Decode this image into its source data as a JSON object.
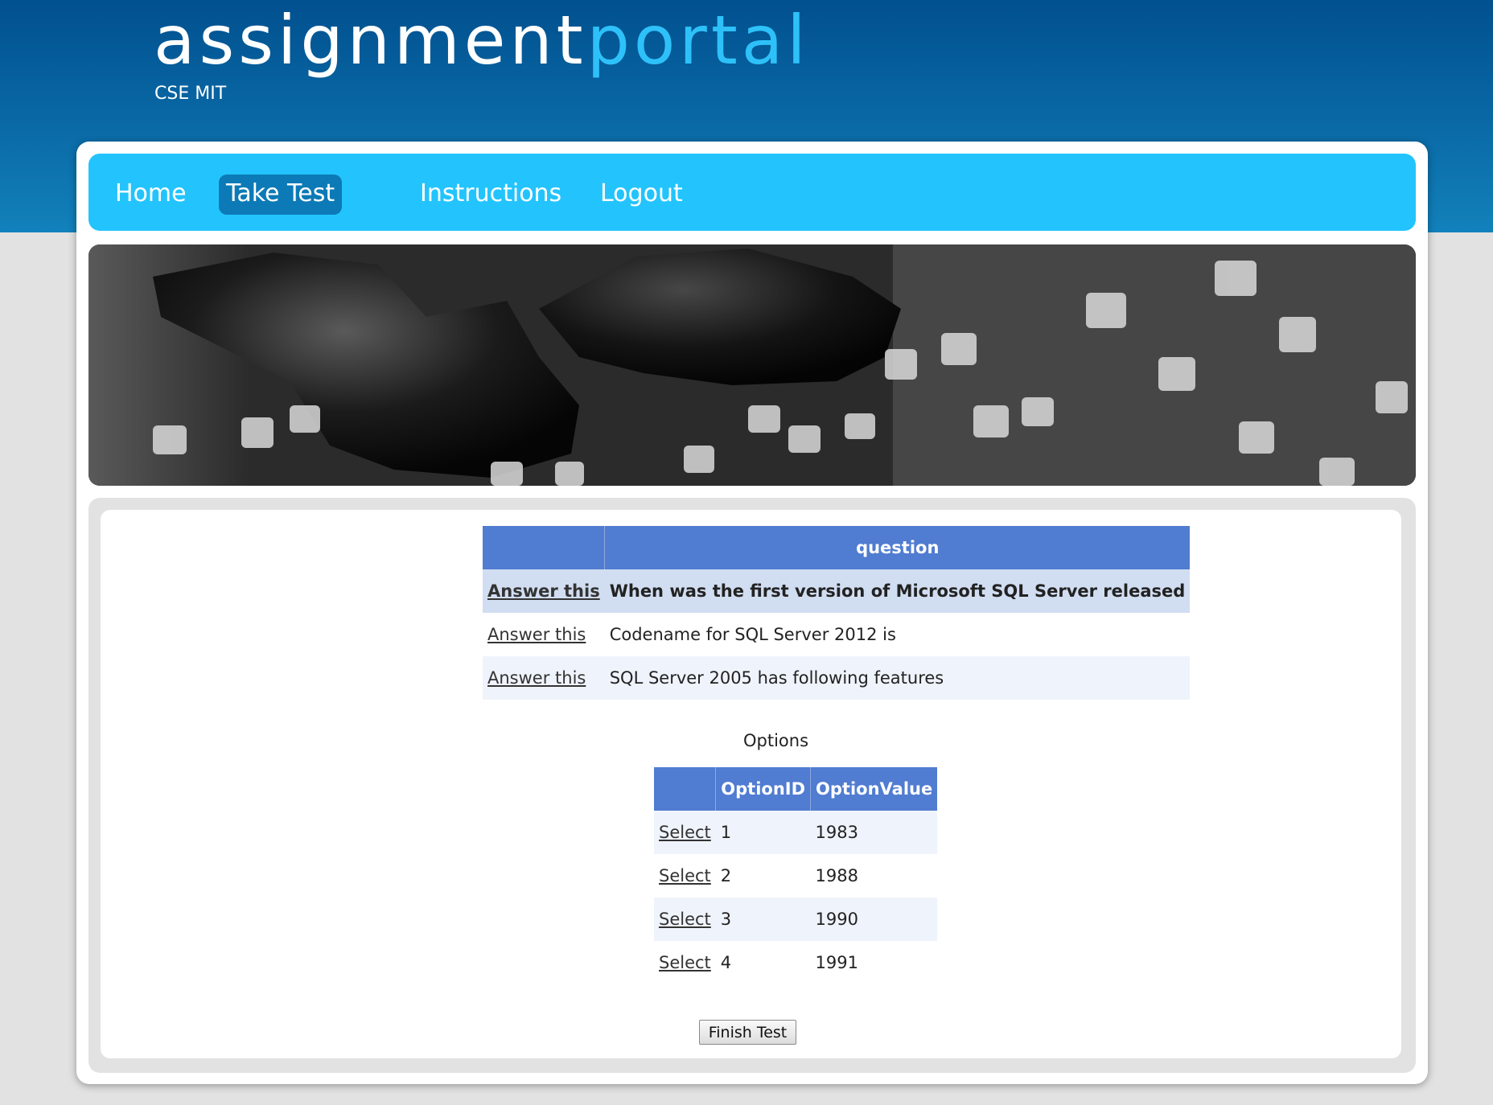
{
  "header": {
    "logo_part1": "assignment",
    "logo_part2": "portal",
    "tagline": "CSE MIT"
  },
  "nav": {
    "items": [
      "Home",
      "Take Test",
      "Instructions",
      "Logout"
    ],
    "active": "Take Test"
  },
  "questions": {
    "columns": [
      "",
      "question"
    ],
    "rows": [
      {
        "link": "Answer this",
        "text": "When was the first version of Microsoft SQL Server released",
        "selected": true
      },
      {
        "link": "Answer this",
        "text": "Codename for SQL Server 2012 is",
        "selected": false
      },
      {
        "link": "Answer this",
        "text": "SQL Server 2005 has following features",
        "selected": false
      }
    ]
  },
  "options": {
    "caption": "Options",
    "columns": [
      "",
      "OptionID",
      "OptionValue"
    ],
    "rows": [
      {
        "link": "Select",
        "id": "1",
        "value": "1983"
      },
      {
        "link": "Select",
        "id": "2",
        "value": "1988"
      },
      {
        "link": "Select",
        "id": "3",
        "value": "1990"
      },
      {
        "link": "Select",
        "id": "4",
        "value": "1991"
      }
    ]
  },
  "finish_button": "Finish Test",
  "colors": {
    "header_dark": "#01508f",
    "logo_accent": "#2ec1f9",
    "nav_bg": "#23c4fd",
    "nav_active": "#0c7ab6",
    "grid_header": "#507cd1",
    "grid_alt_row": "#eff3fb",
    "grid_selected_row": "#d1ddf1"
  }
}
